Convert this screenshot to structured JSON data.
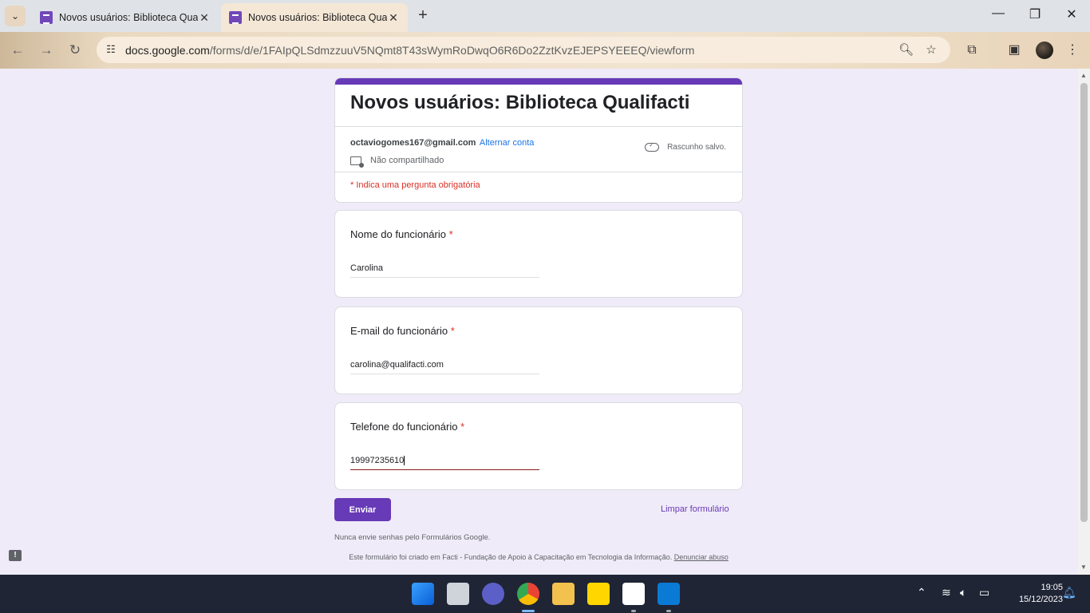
{
  "browser": {
    "tabs": [
      {
        "title": "Novos usuários: Biblioteca Quali",
        "active": false
      },
      {
        "title": "Novos usuários: Biblioteca Qual",
        "active": true
      }
    ],
    "new_tab": "+",
    "url_host": "docs.google.com",
    "url_path": "/forms/d/e/1FAIpQLSdmzzuuV5NQmt8T43sWymRoDwqO6R6Do2ZztKvzEJEPSYEEEQ/viewform"
  },
  "form": {
    "title": "Novos usuários: Biblioteca Qualifacti",
    "account_email": "octaviogomes167@gmail.com",
    "switch_account": "Alternar conta",
    "not_shared": "Não compartilhado",
    "draft_status": "Rascunho salvo.",
    "required_note": "* Indica uma pergunta obrigatória",
    "questions": [
      {
        "label": "Nome do funcionário",
        "required": "*",
        "value": "Carolina"
      },
      {
        "label": "E-mail do funcionário",
        "required": "*",
        "value": "carolina@qualifacti.com"
      },
      {
        "label": "Telefone do funcionário",
        "required": "*",
        "value": "19997235610"
      }
    ],
    "submit_label": "Enviar",
    "clear_label": "Limpar formulário",
    "never_note": "Nunca envie senhas pelo Formulários Google.",
    "footer_text": "Este formulário foi criado em Facti - Fundação de Apoio à Capacitação em Tecnologia da Informação.",
    "report_link": "Denunciar abuso",
    "accent_color": "#673ab7"
  },
  "taskbar": {
    "time": "19:05",
    "date": "15/12/2023"
  }
}
